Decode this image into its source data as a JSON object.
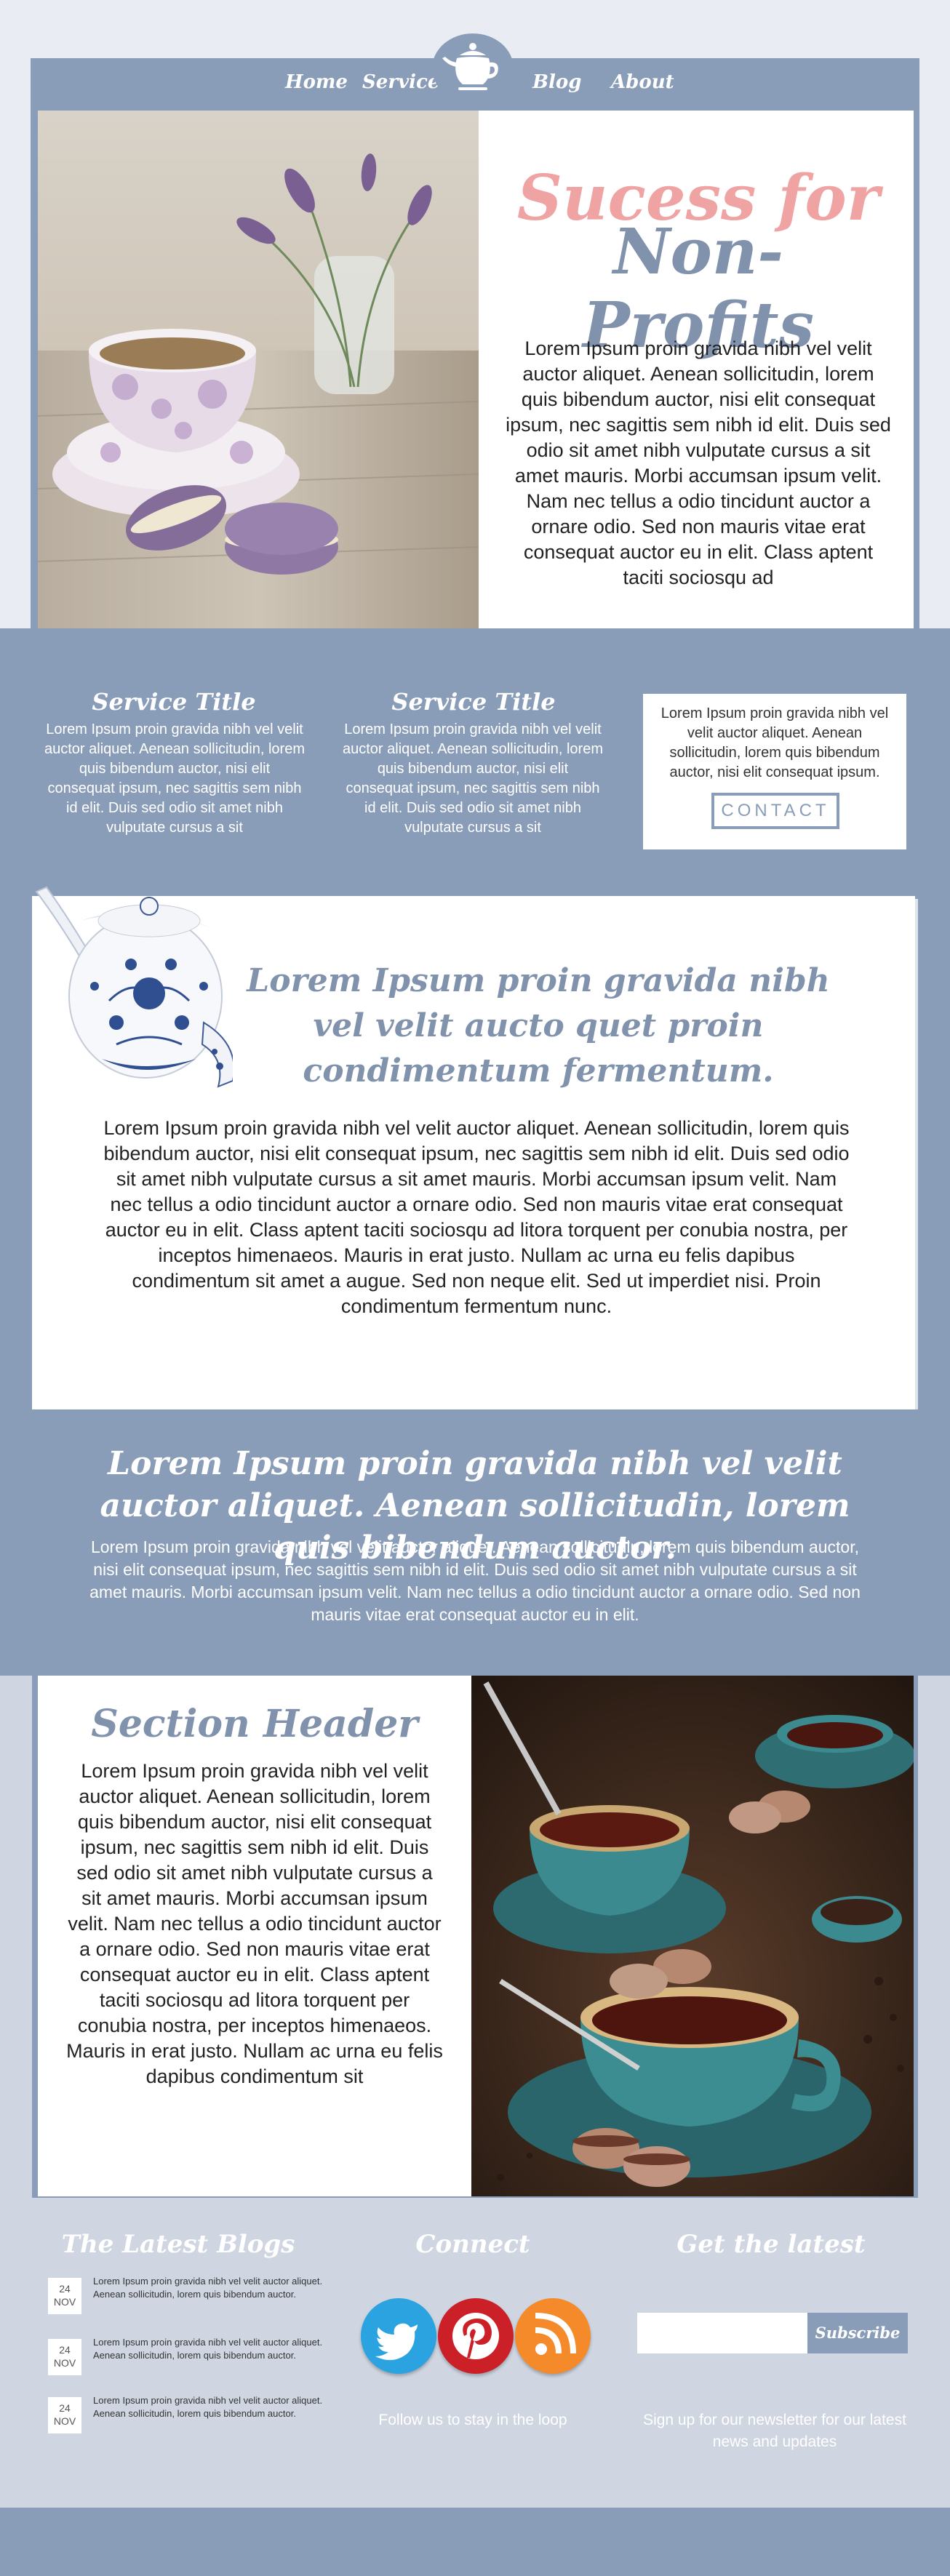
{
  "nav": {
    "links": [
      "Home",
      "Services",
      "Blog",
      "About"
    ]
  },
  "hero": {
    "title_line1": "Sucess for",
    "title_line2": "Non-Profits",
    "body": "Lorem Ipsum proin gravida nibh vel velit auctor aliquet. Aenean sollicitudin, lorem quis bibendum auctor, nisi elit consequat ipsum, nec sagittis sem nibh id elit. Duis sed odio sit amet nibh vulputate cursus a sit amet mauris. Morbi accumsan ipsum velit. Nam nec tellus a odio tincidunt auctor a ornare odio. Sed non  mauris vitae erat consequat auctor eu in elit. Class aptent taciti sociosqu ad"
  },
  "services": [
    {
      "title": "Service Title",
      "text": "Lorem Ipsum proin gravida nibh vel velit auctor aliquet. Aenean sollicitudin, lorem quis bibendum auctor, nisi elit consequat ipsum, nec sagittis sem nibh id elit. Duis sed odio sit amet nibh vulputate cursus a sit"
    },
    {
      "title": "Service Title",
      "text": "Lorem Ipsum proin gravida nibh vel velit auctor aliquet. Aenean sollicitudin, lorem quis bibendum auctor, nisi elit consequat ipsum, nec sagittis sem nibh id elit. Duis sed odio sit amet nibh vulputate cursus a sit"
    }
  ],
  "contact": {
    "text": "Lorem Ipsum proin gravida nibh vel velit auctor aliquet. Aenean sollicitudin, lorem quis bibendum auctor, nisi elit consequat ipsum.",
    "button": "CONTACT"
  },
  "feature": {
    "heading": "Lorem Ipsum proin gravida nibh vel velit aucto quet proin condimentum fermentum.",
    "body": "Lorem Ipsum proin gravida nibh vel velit auctor aliquet. Aenean sollicitudin, lorem quis bibendum auctor, nisi elit consequat ipsum, nec sagittis sem nibh id elit. Duis sed odio sit amet nibh vulputate cursus a sit amet mauris. Morbi accumsan ipsum velit. Nam nec tellus a odio tincidunt auctor a ornare odio. Sed non  mauris vitae erat consequat auctor eu in elit. Class aptent taciti sociosqu ad litora torquent per conubia nostra, per inceptos himenaeos. Mauris in erat justo. Nullam ac urna eu felis dapibus condimentum sit amet a augue. Sed non neque elit. Sed ut imperdiet nisi. Proin condimentum fermentum nunc."
  },
  "band": {
    "heading": "Lorem Ipsum proin gravida nibh vel velit auctor aliquet. Aenean sollicitudin, lorem quis bibendum auctor.",
    "body": "Lorem Ipsum proin gravida nibh vel velit auctor aliquet. Aenean sollicitudin, lorem quis bibendum auctor, nisi elit consequat ipsum, nec sagittis sem nibh id elit. Duis sed odio sit amet nibh vulputate cursus a sit amet mauris. Morbi accumsan ipsum velit. Nam nec tellus a odio tincidunt auctor a ornare odio. Sed non  mauris vitae erat consequat auctor eu in elit."
  },
  "section": {
    "header": "Section Header",
    "body": "Lorem Ipsum proin gravida nibh vel velit auctor aliquet. Aenean sollicitudin, lorem quis bibendum auctor, nisi elit consequat ipsum, nec sagittis sem nibh id elit. Duis sed odio sit amet nibh vulputate cursus a sit amet mauris. Morbi accumsan ipsum velit. Nam nec tellus a odio tincidunt auctor a ornare odio. Sed non mauris vitae erat consequat auctor eu in elit. Class aptent taciti sociosqu ad litora torquent per conubia nostra, per inceptos himenaeos. Mauris in erat justo. Nullam ac urna eu felis dapibus condimentum sit"
  },
  "footer": {
    "blogs_title": "The Latest Blogs",
    "blogs": [
      {
        "day": "24",
        "month": "NOV",
        "text": "Lorem Ipsum proin gravida nibh vel velit auctor aliquet. Aenean sollicitudin, lorem quis bibendum auctor."
      },
      {
        "day": "24",
        "month": "NOV",
        "text": "Lorem Ipsum proin gravida nibh vel velit auctor aliquet. Aenean sollicitudin, lorem quis bibendum auctor."
      },
      {
        "day": "24",
        "month": "NOV",
        "text": "Lorem Ipsum proin gravida nibh vel velit auctor aliquet. Aenean sollicitudin, lorem quis bibendum auctor."
      }
    ],
    "connect_title": "Connect",
    "social_icons": [
      "twitter-icon",
      "pinterest-icon",
      "rss-icon"
    ],
    "connect_note": "Follow us to stay in the loop",
    "latest_title": "Get the latest",
    "subscribe_label": "Subscribe",
    "subscribe_placeholder": "",
    "latest_note": "Sign up for our newsletter for our latest news and updates"
  },
  "colors": {
    "accent": "#8a9db8",
    "title_pink": "#f0a3a3",
    "twitter": "#2aa3e0",
    "pinterest": "#cb2027",
    "rss": "#f58a2a"
  }
}
